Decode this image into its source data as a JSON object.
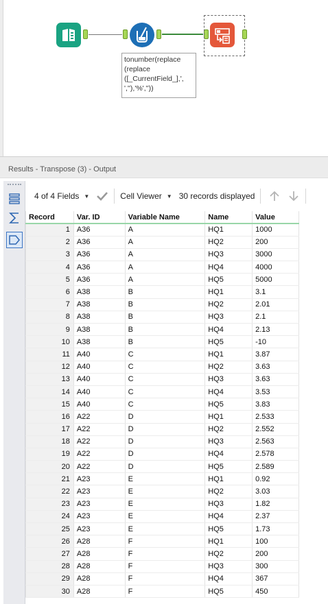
{
  "canvas": {
    "annotation": "tonumber(replace\n(replace\n([_CurrentField_],',\n',''),'%',''))"
  },
  "results": {
    "title": "Results - Transpose (3) - Output"
  },
  "toolbar": {
    "fields_label": "4 of 4 Fields",
    "viewer_label": "Cell Viewer",
    "records_label": "30 records displayed"
  },
  "grid": {
    "headers": [
      "Record",
      "Var. ID",
      "Variable Name",
      "Name",
      "Value"
    ],
    "rows": [
      [
        "1",
        "A36",
        "A",
        "HQ1",
        "1000"
      ],
      [
        "2",
        "A36",
        "A",
        "HQ2",
        "200"
      ],
      [
        "3",
        "A36",
        "A",
        "HQ3",
        "3000"
      ],
      [
        "4",
        "A36",
        "A",
        "HQ4",
        "4000"
      ],
      [
        "5",
        "A36",
        "A",
        "HQ5",
        "5000"
      ],
      [
        "6",
        "A38",
        "B",
        "HQ1",
        "3.1"
      ],
      [
        "7",
        "A38",
        "B",
        "HQ2",
        "2.01"
      ],
      [
        "8",
        "A38",
        "B",
        "HQ3",
        "2.1"
      ],
      [
        "9",
        "A38",
        "B",
        "HQ4",
        "2.13"
      ],
      [
        "10",
        "A38",
        "B",
        "HQ5",
        "-10"
      ],
      [
        "11",
        "A40",
        "C",
        "HQ1",
        "3.87"
      ],
      [
        "12",
        "A40",
        "C",
        "HQ2",
        "3.63"
      ],
      [
        "13",
        "A40",
        "C",
        "HQ3",
        "3.63"
      ],
      [
        "14",
        "A40",
        "C",
        "HQ4",
        "3.53"
      ],
      [
        "15",
        "A40",
        "C",
        "HQ5",
        "3.83"
      ],
      [
        "16",
        "A22",
        "D",
        "HQ1",
        "2.533"
      ],
      [
        "17",
        "A22",
        "D",
        "HQ2",
        "2.552"
      ],
      [
        "18",
        "A22",
        "D",
        "HQ3",
        "2.563"
      ],
      [
        "19",
        "A22",
        "D",
        "HQ4",
        "2.578"
      ],
      [
        "20",
        "A22",
        "D",
        "HQ5",
        "2.589"
      ],
      [
        "21",
        "A23",
        "E",
        "HQ1",
        "0.92"
      ],
      [
        "22",
        "A23",
        "E",
        "HQ2",
        "3.03"
      ],
      [
        "23",
        "A23",
        "E",
        "HQ3",
        "1.82"
      ],
      [
        "24",
        "A23",
        "E",
        "HQ4",
        "2.37"
      ],
      [
        "25",
        "A23",
        "E",
        "HQ5",
        "1.73"
      ],
      [
        "26",
        "A28",
        "F",
        "HQ1",
        "100"
      ],
      [
        "27",
        "A28",
        "F",
        "HQ2",
        "200"
      ],
      [
        "28",
        "A28",
        "F",
        "HQ3",
        "300"
      ],
      [
        "29",
        "A28",
        "F",
        "HQ4",
        "367"
      ],
      [
        "30",
        "A28",
        "F",
        "HQ5",
        "450"
      ]
    ]
  }
}
